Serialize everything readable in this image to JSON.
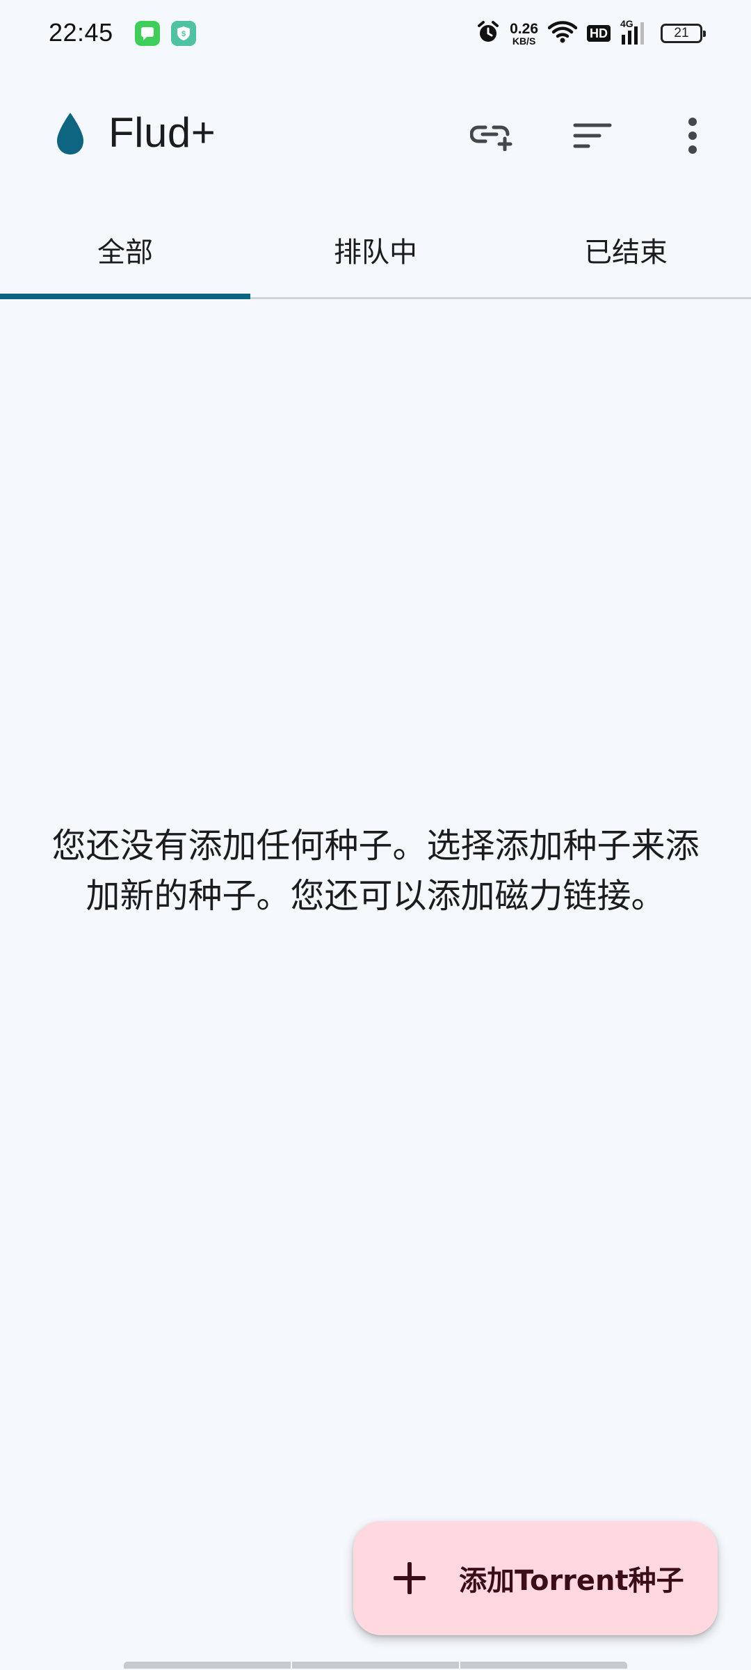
{
  "status_bar": {
    "time": "22:45",
    "app_icons": [
      "messages-icon",
      "security-shield-icon"
    ],
    "net_speed_value": "0.26",
    "net_speed_unit": "KB/S",
    "hd_label": "HD",
    "network_type": "4G",
    "battery": "21"
  },
  "app_bar": {
    "title": "Flud+",
    "logo_icon": "water-drop-icon",
    "actions": [
      "add-link-icon",
      "sort-icon",
      "more-vert-icon"
    ],
    "accent_color": "#0e6582"
  },
  "tabs": [
    {
      "label": "全部",
      "active": true
    },
    {
      "label": "排队中",
      "active": false
    },
    {
      "label": "已结束",
      "active": false
    }
  ],
  "empty_state": {
    "message": "您还没有添加任何种子。选择添加种子来添加新的种子。您还可以添加磁力链接。"
  },
  "fab": {
    "label": "添加Torrent种子",
    "icon": "plus-icon",
    "color": "#ffd9df"
  }
}
